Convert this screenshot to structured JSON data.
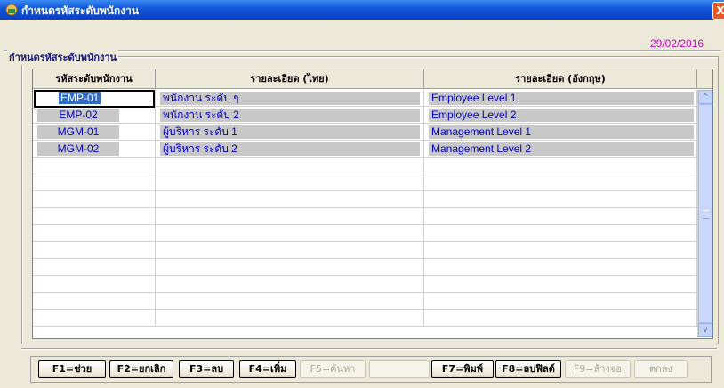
{
  "window": {
    "title": "กำหนดรหัสระดับพนักงาน",
    "close_label": "X"
  },
  "date": "29/02/2016",
  "group_label": "กำหนดรหัสระดับพนักงาน",
  "grid": {
    "headers": [
      "รหัสระดับพนักงาน",
      "รายละเอียด (ไทย)",
      "รายละเอียด (อังกฤษ)"
    ],
    "rows": [
      {
        "code": "EMP-01",
        "thai": "พนักงาน ระดับ ๆ",
        "eng": "Employee Level 1"
      },
      {
        "code": "EMP-02",
        "thai": "พนักงาน ระดับ 2",
        "eng": "Employee Level 2"
      },
      {
        "code": "MGM-01",
        "thai": "ผู้บริหาร ระดับ 1",
        "eng": "Management Level 1"
      },
      {
        "code": "MGM-02",
        "thai": "ผู้บริหาร ระดับ 2",
        "eng": "Management Level 2"
      }
    ]
  },
  "buttons": {
    "help": "F1=ช่วย",
    "cancel": "F2=ยกเลิก",
    "delete": "F3=ลบ",
    "add": "F4=เพิ่ม",
    "search": "F5=ค้นหา",
    "print": "F7=พิมพ์",
    "delete_field": "F8=ลบฟิลด์",
    "clear": "F9=ล้างจอ",
    "ok": "ตกลง"
  },
  "scrollbar": {
    "up": "^",
    "down": "v"
  }
}
